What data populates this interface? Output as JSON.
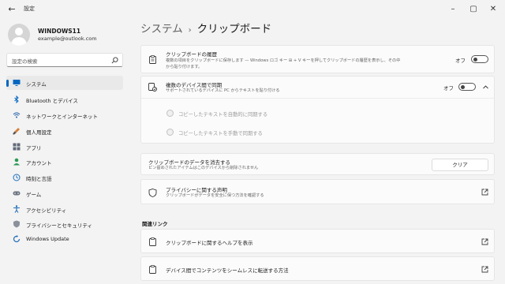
{
  "window": {
    "title": "設定"
  },
  "profile": {
    "name": "WINDOWS11",
    "email": "example@outlook.com"
  },
  "search": {
    "placeholder": "設定の検索"
  },
  "sidebar": {
    "items": [
      {
        "label": "システム",
        "icon": "monitor-icon",
        "active": true
      },
      {
        "label": "Bluetooth とデバイス",
        "icon": "bluetooth-icon"
      },
      {
        "label": "ネットワークとインターネット",
        "icon": "network-icon"
      },
      {
        "label": "個人用設定",
        "icon": "brush-icon"
      },
      {
        "label": "アプリ",
        "icon": "apps-icon"
      },
      {
        "label": "アカウント",
        "icon": "account-icon"
      },
      {
        "label": "時刻と言語",
        "icon": "globe-clock-icon"
      },
      {
        "label": "ゲーム",
        "icon": "gamepad-icon"
      },
      {
        "label": "アクセシビリティ",
        "icon": "accessibility-icon"
      },
      {
        "label": "プライバシーとセキュリティ",
        "icon": "shield-icon"
      },
      {
        "label": "Windows Update",
        "icon": "update-icon"
      }
    ]
  },
  "header": {
    "crumb": "システム",
    "separator": "›",
    "title": "クリップボード"
  },
  "clipboard_history": {
    "title": "クリップボードの履歴",
    "desc_line1": "複数の項目をクリップボードに保存します — Windows ロゴ キー ⊞ + V キーを押してクリップボードの履歴を表示し、その中",
    "desc_line2": "から貼り付けます。",
    "toggle_label": "オフ",
    "toggle_on": false
  },
  "sync": {
    "title": "複数のデバイス間で同期",
    "desc": "サポートされているデバイスに PC からテキストを貼り付ける",
    "toggle_label": "オフ",
    "toggle_on": false,
    "options": [
      "コピーしたテキストを自動的に同期する",
      "コピーしたテキストを手動で同期する"
    ]
  },
  "clear": {
    "title": "クリップボードのデータを消去する",
    "desc": "ピン留めされたアイテムはこのデバイスから削除されません",
    "button": "クリア"
  },
  "privacy": {
    "title": "プライバシーに関する声明",
    "desc": "クリップボードがデータを安全に保つ方法を確認する"
  },
  "related": {
    "heading": "関連リンク",
    "links": [
      "クリップボードに関するヘルプを表示",
      "デバイス間でコンテンツをシームレスに転送する方法"
    ]
  },
  "colors": {
    "accent": "#0067c0",
    "background": "#f3f3f3",
    "card": "#fbfbfb"
  }
}
